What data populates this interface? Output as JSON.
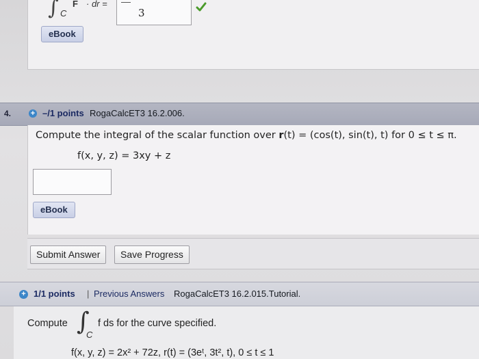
{
  "top_question": {
    "expression_F": "F",
    "expression_dr": "· dr =",
    "integral_subscript": "C",
    "answer_value": "3",
    "status": "correct",
    "ebook_label": "eBook"
  },
  "question4": {
    "number": "4.",
    "points": "–/1 points",
    "source": "RogaCalcET3 16.2.006.",
    "prompt_start": "Compute the integral of the scalar function over ",
    "prompt_r": "r",
    "prompt_mid": "(t) = (cos(t), sin(t), t) for 0 ≤ t ≤ π.",
    "function": "f(x, y, z) = 3xy + z",
    "answer_value": "",
    "ebook_label": "eBook",
    "submit_label": "Submit Answer",
    "save_label": "Save Progress"
  },
  "question5": {
    "points": "1/1 points",
    "separator": "|",
    "previous_answers_label": "Previous Answers",
    "source": "RogaCalcET3 16.2.015.Tutorial.",
    "compute_label": "Compute",
    "integral_subscript": "C",
    "rest": "f ds for the curve specified.",
    "function_line": "f(x, y, z) = 2x² + 72z,  r(t) = (3eᵗ, 3t², t),  0 ≤ t ≤ 1"
  },
  "colors": {
    "link_blue": "#1b2a62",
    "plus_icon": "#3c86c8",
    "check_green": "#4a9a2a"
  }
}
